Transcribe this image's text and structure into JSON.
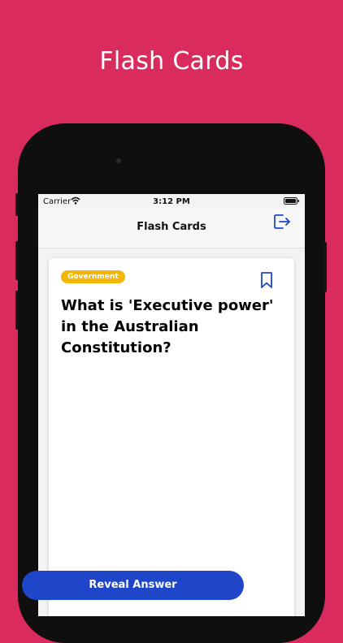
{
  "banner": {
    "title": "Flash Cards"
  },
  "status": {
    "carrier": "Carrier",
    "time": "3:12 PM"
  },
  "navbar": {
    "title": "Flash Cards",
    "logout_icon": "logout-icon"
  },
  "card": {
    "tag": "Government",
    "question": "What is 'Executive power' in the Australian Constitution?",
    "bookmark_icon": "bookmark-icon",
    "reveal_label": "Reveal Answer"
  },
  "colors": {
    "background": "#d92b5e",
    "accent": "#1f46c8",
    "tag": "#f2b705"
  }
}
